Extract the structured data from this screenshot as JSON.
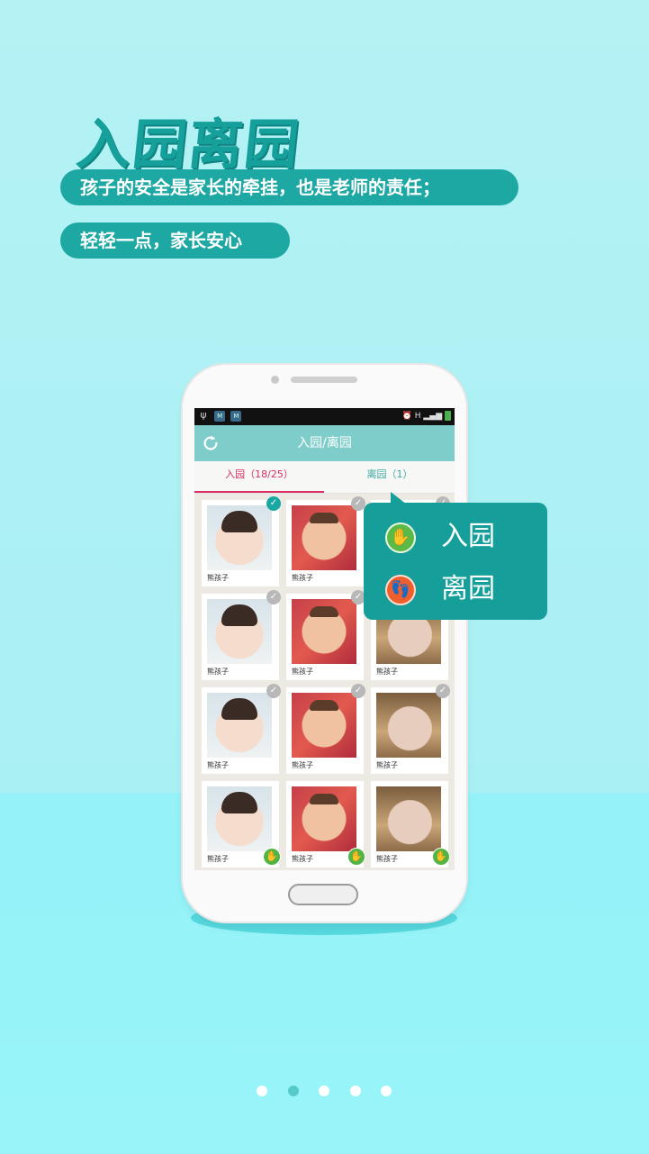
{
  "hero": {
    "title": "入园离园",
    "line1": "孩子的安全是家长的牵挂，也是老师的责任；",
    "line2": "轻轻一点，家长安心"
  },
  "phone": {
    "statusbar": {
      "network": "H",
      "signal": "signal-bars-icon",
      "battery": "battery-icon"
    },
    "appbar": {
      "title": "入园/离园",
      "refresh_icon": "refresh-icon"
    },
    "tabs": [
      {
        "label": "入园（18/25）",
        "active": true
      },
      {
        "label": "离园（1）",
        "active": false
      }
    ],
    "cards": [
      {
        "name": "熊孩子",
        "photo": "a",
        "checked": true,
        "badge": false
      },
      {
        "name": "熊孩子",
        "photo": "b",
        "checked": false,
        "badge": false
      },
      {
        "name": "熊孩子",
        "photo": "c",
        "checked": false,
        "badge": false
      },
      {
        "name": "熊孩子",
        "photo": "a",
        "checked": false,
        "badge": false
      },
      {
        "name": "熊孩子",
        "photo": "b",
        "checked": false,
        "badge": false
      },
      {
        "name": "熊孩子",
        "photo": "c",
        "checked": false,
        "badge": false
      },
      {
        "name": "熊孩子",
        "photo": "a",
        "checked": false,
        "badge": false
      },
      {
        "name": "熊孩子",
        "photo": "b",
        "checked": false,
        "badge": false
      },
      {
        "name": "熊孩子",
        "photo": "c",
        "checked": false,
        "badge": false
      },
      {
        "name": "熊孩子",
        "photo": "a",
        "checked": false,
        "badge": true
      },
      {
        "name": "熊孩子",
        "photo": "b",
        "checked": false,
        "badge": true
      },
      {
        "name": "熊孩子",
        "photo": "c",
        "checked": false,
        "badge": true
      }
    ]
  },
  "popup": {
    "items": [
      {
        "label": "入园",
        "icon": "hand-icon",
        "color": "#5bba46"
      },
      {
        "label": "离园",
        "icon": "footprint-icon",
        "color": "#ef5f2d"
      }
    ]
  },
  "pager": {
    "count": 5,
    "active_index": 1
  },
  "colors": {
    "accent": "#169f9a",
    "tab_active": "#d92c63",
    "appbar": "#7fcdcb"
  }
}
